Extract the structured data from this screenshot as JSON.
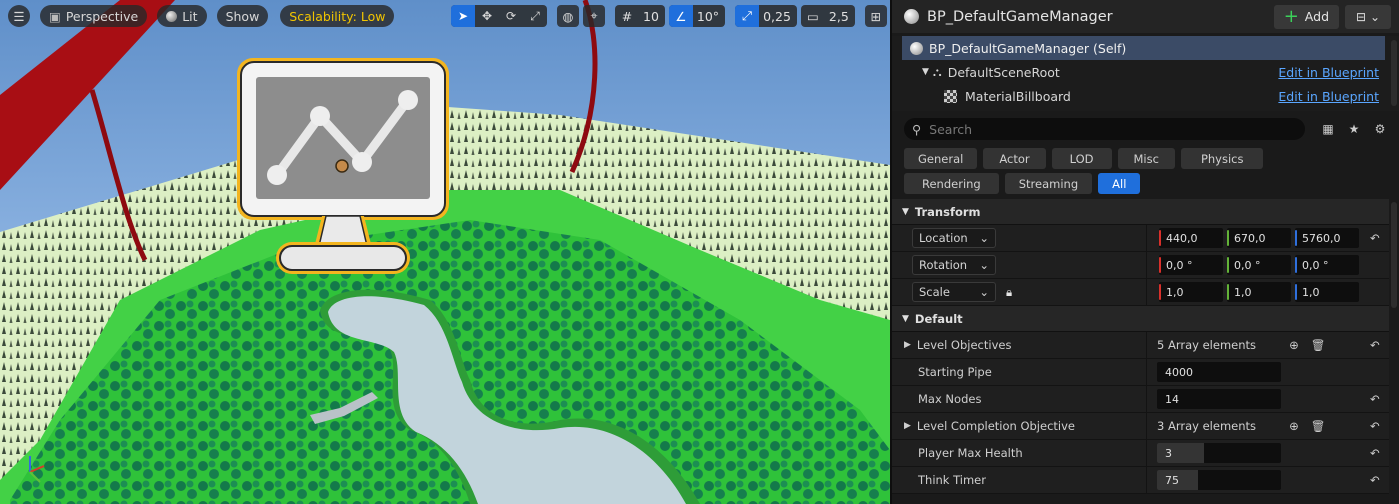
{
  "viewport": {
    "menu_icon": "hamburger-icon",
    "perspective_label": "Perspective",
    "lit_label": "Lit",
    "show_label": "Show",
    "scalability_label": "Scalability: Low",
    "grid_snap": "10",
    "rotation_snap": "10°",
    "scale_snap": "0,25",
    "camera_speed": "2,5",
    "accent_color": "#1f6fdc"
  },
  "details": {
    "actor_name": "BP_DefaultGameManager",
    "add_label": "Add",
    "components": [
      {
        "label": "BP_DefaultGameManager (Self)",
        "edit": ""
      },
      {
        "label": "DefaultSceneRoot",
        "edit": "Edit in Blueprint"
      },
      {
        "label": "MaterialBillboard",
        "edit": "Edit in Blueprint"
      }
    ],
    "search_placeholder": "Search",
    "filters": [
      "General",
      "Actor",
      "LOD",
      "Misc",
      "Physics",
      "Rendering",
      "Streaming",
      "All"
    ],
    "categories": {
      "transform": "Transform",
      "default": "Default"
    },
    "transform": {
      "location": {
        "label": "Location",
        "x": "440,0",
        "y": "670,0",
        "z": "5760,0"
      },
      "rotation": {
        "label": "Rotation",
        "x": "0,0 °",
        "y": "0,0 °",
        "z": "0,0 °"
      },
      "scale": {
        "label": "Scale",
        "x": "1,0",
        "y": "1,0",
        "z": "1,0"
      }
    },
    "defaults": {
      "level_objectives": {
        "label": "Level Objectives",
        "value": "5 Array elements"
      },
      "starting_pipe": {
        "label": "Starting Pipe",
        "value": "4000"
      },
      "max_nodes": {
        "label": "Max Nodes",
        "value": "14"
      },
      "level_completion": {
        "label": "Level Completion Objective",
        "value": "3 Array elements"
      },
      "player_max_health": {
        "label": "Player Max Health",
        "value": "3",
        "fill": 0.38
      },
      "think_timer": {
        "label": "Think Timer",
        "value": "75",
        "fill": 0.33
      }
    }
  }
}
